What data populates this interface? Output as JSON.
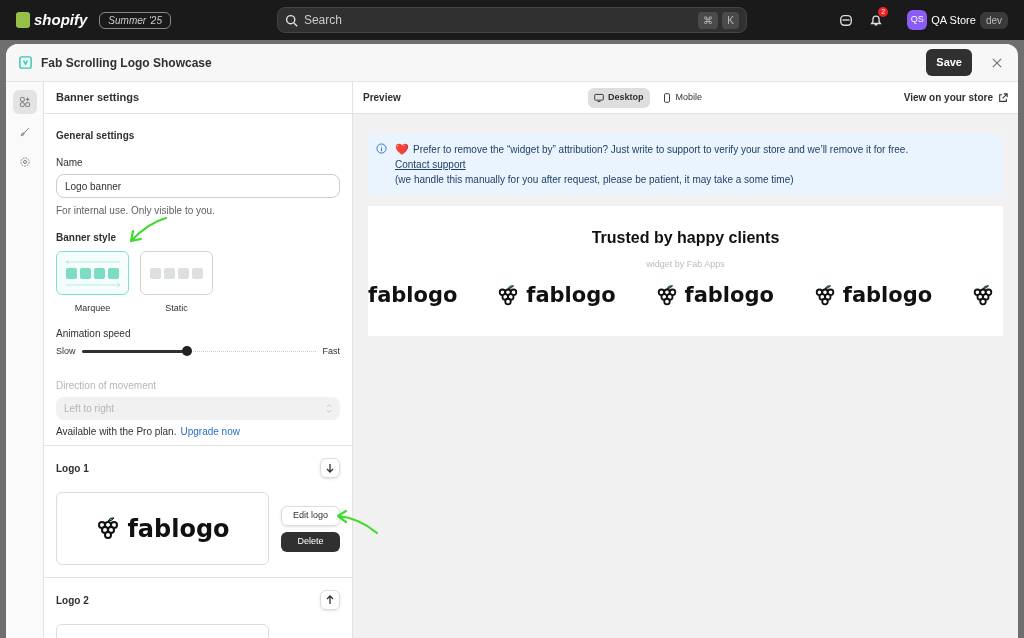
{
  "topbar": {
    "brand": "shopify",
    "edition": "Summer '25",
    "search": {
      "placeholder": "Search"
    },
    "shortcut_keys": [
      "⌘",
      "K"
    ],
    "notification_count": "2",
    "avatar_initials": "QS",
    "store_name": "QA Store",
    "store_badge": "dev"
  },
  "modal": {
    "title": "Fab Scrolling Logo Showcase",
    "save_label": "Save"
  },
  "rail": [
    {
      "kind": "blocks",
      "selected": true
    },
    {
      "kind": "brush",
      "selected": false
    },
    {
      "kind": "settings",
      "selected": false
    }
  ],
  "settings": {
    "header": "Banner settings",
    "section_title": "General settings",
    "name_label": "Name",
    "name_value": "Logo banner",
    "name_help": "For internal use. Only visible to you.",
    "style_label": "Banner style",
    "styles": [
      {
        "kind": "marquee",
        "label": "Marquee",
        "selected": true
      },
      {
        "kind": "static",
        "label": "Static",
        "selected": false
      }
    ],
    "speed_label": "Animation speed",
    "speed_min": "Slow",
    "speed_max": "Fast",
    "speed": {
      "level": 0.45
    },
    "direction_label": "Direction of movement",
    "direction_value": "Left to right",
    "direction_disabled": true,
    "pro_note": "Available with the Pro plan.",
    "upgrade_link": "Upgrade now",
    "logos": [
      {
        "title": "Logo 1",
        "kind": "down",
        "logo_text": "fablogo",
        "edit_label": "Edit logo",
        "delete_label": "Delete"
      },
      {
        "title": "Logo 2",
        "kind": "up"
      }
    ]
  },
  "preview": {
    "title": "Preview",
    "tabs": [
      {
        "label": "Desktop",
        "kind": "desktop",
        "selected": true
      },
      {
        "label": "Mobile",
        "kind": "mobile",
        "selected": false
      }
    ],
    "view_link": "View on your store",
    "notice": {
      "heart": "❤️",
      "text": "Prefer to remove the “widget by” attribution? Just write to support to verify your store and we’ll remove it for free.",
      "link": "Contact support",
      "note": "(we handle this manually for you after request, please be patient, it may take a some time)"
    },
    "banner": {
      "heading": "Trusted by happy clients",
      "attribution": "widget by Fab Apps",
      "logos": [
        {
          "icon": false,
          "text": "fablogo"
        },
        {
          "icon": true,
          "text": "fablogo"
        },
        {
          "icon": true,
          "text": "fablogo"
        },
        {
          "icon": true,
          "text": "fablogo"
        },
        {
          "icon": true
        }
      ]
    }
  }
}
